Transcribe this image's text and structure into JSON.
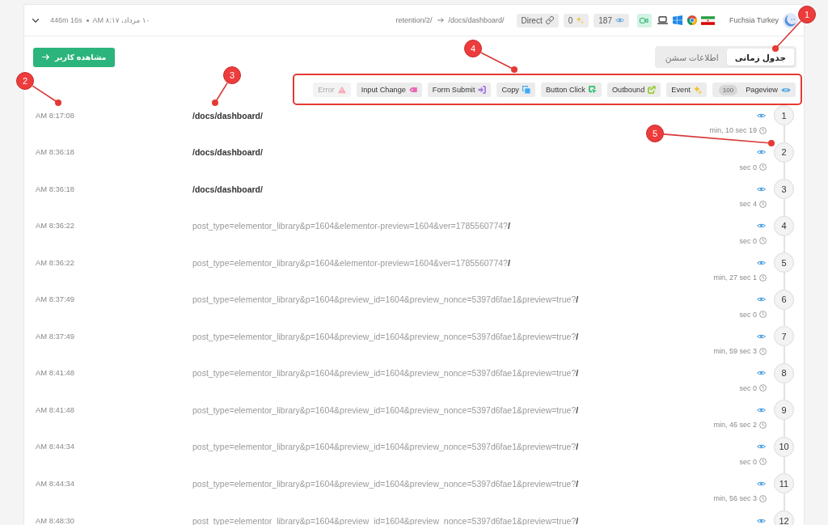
{
  "session": {
    "duration": "446m 16s",
    "date": "۱۰ مرداد، ۸:۱۷ AM",
    "entry_path": "retention/2/",
    "landing_path": "/docs/dashboard/",
    "badges": [
      {
        "kind": "source",
        "label": "Direct"
      },
      {
        "kind": "events",
        "label": "0"
      },
      {
        "kind": "pageviews",
        "label": "187"
      }
    ],
    "user_name": "Fuchsia Turkey"
  },
  "view_user_button": {
    "label": "مشاهده کاربر"
  },
  "tabs": [
    {
      "label": "جدول زمانی",
      "selected": true
    },
    {
      "label": "اطلاعات سشن",
      "selected": false
    }
  ],
  "filters": {
    "highlighted": true,
    "items": [
      {
        "kind": "error",
        "label": "Error",
        "color": "#f6a9b6",
        "disabled": true
      },
      {
        "kind": "input",
        "label": "Input Change",
        "color": "#e86ab6",
        "disabled": false
      },
      {
        "kind": "submit",
        "label": "Form Submit",
        "color": "#a77be0",
        "disabled": false
      },
      {
        "kind": "copy",
        "label": "Copy",
        "color": "#3fa9f5",
        "disabled": false
      },
      {
        "kind": "click",
        "label": "Button Click",
        "color": "#2fbf71",
        "disabled": false
      },
      {
        "kind": "outbound",
        "label": "Outbound",
        "color": "#9ccc3c",
        "disabled": false
      },
      {
        "kind": "event",
        "label": "Event",
        "color": "#f2c230",
        "disabled": false
      },
      {
        "kind": "pageview",
        "label": "Pageview",
        "count": "100",
        "color": "#5aa9e6",
        "disabled": false
      }
    ]
  },
  "timeline": [
    {
      "number": "1",
      "time": "AM 8:17:08",
      "path": "/docs/dashboard/",
      "duration": "min, 10 sec 19"
    },
    {
      "number": "2",
      "time": "AM 8:36:18",
      "path": "/docs/dashboard/",
      "duration": "sec 0"
    },
    {
      "number": "3",
      "time": "AM 8:36:18",
      "path": "/docs/dashboard/",
      "duration": "sec 4"
    },
    {
      "number": "4",
      "time": "AM 8:36:22",
      "query": "post_type=elementor_library&p=1604&elementor-preview=1604&ver=1785560774?",
      "path": "/",
      "duration": "sec 0"
    },
    {
      "number": "5",
      "time": "AM 8:36:22",
      "query": "post_type=elementor_library&p=1604&elementor-preview=1604&ver=1785560774?",
      "path": "/",
      "duration": "min, 27 sec 1"
    },
    {
      "number": "6",
      "time": "AM 8:37:49",
      "query": "post_type=elementor_library&p=1604&preview_id=1604&preview_nonce=5397d6fae1&preview=true?",
      "path": "/",
      "duration": "sec 0"
    },
    {
      "number": "7",
      "time": "AM 8:37:49",
      "query": "post_type=elementor_library&p=1604&preview_id=1604&preview_nonce=5397d6fae1&preview=true?",
      "path": "/",
      "duration": "min, 59 sec 3"
    },
    {
      "number": "8",
      "time": "AM 8:41:48",
      "query": "post_type=elementor_library&p=1604&preview_id=1604&preview_nonce=5397d6fae1&preview=true?",
      "path": "/",
      "duration": "sec 0"
    },
    {
      "number": "9",
      "time": "AM 8:41:48",
      "query": "post_type=elementor_library&p=1604&preview_id=1604&preview_nonce=5397d6fae1&preview=true?",
      "path": "/",
      "duration": "min, 46 sec 2"
    },
    {
      "number": "10",
      "time": "AM 8:44:34",
      "query": "post_type=elementor_library&p=1604&preview_id=1604&preview_nonce=5397d6fae1&preview=true?",
      "path": "/",
      "duration": "sec 0"
    },
    {
      "number": "11",
      "time": "AM 8:44:34",
      "query": "post_type=elementor_library&p=1604&preview_id=1604&preview_nonce=5397d6fae1&preview=true?",
      "path": "/",
      "duration": "min, 56 sec 3"
    },
    {
      "number": "12",
      "time": "AM 8:48:30",
      "query": "post_type=elementor_library&p=1604&preview_id=1604&preview_nonce=5397d6fae1&preview=true?",
      "path": "/"
    }
  ],
  "annotations": [
    {
      "label": "1"
    },
    {
      "label": "2"
    },
    {
      "label": "3"
    },
    {
      "label": "4"
    },
    {
      "label": "5"
    }
  ]
}
